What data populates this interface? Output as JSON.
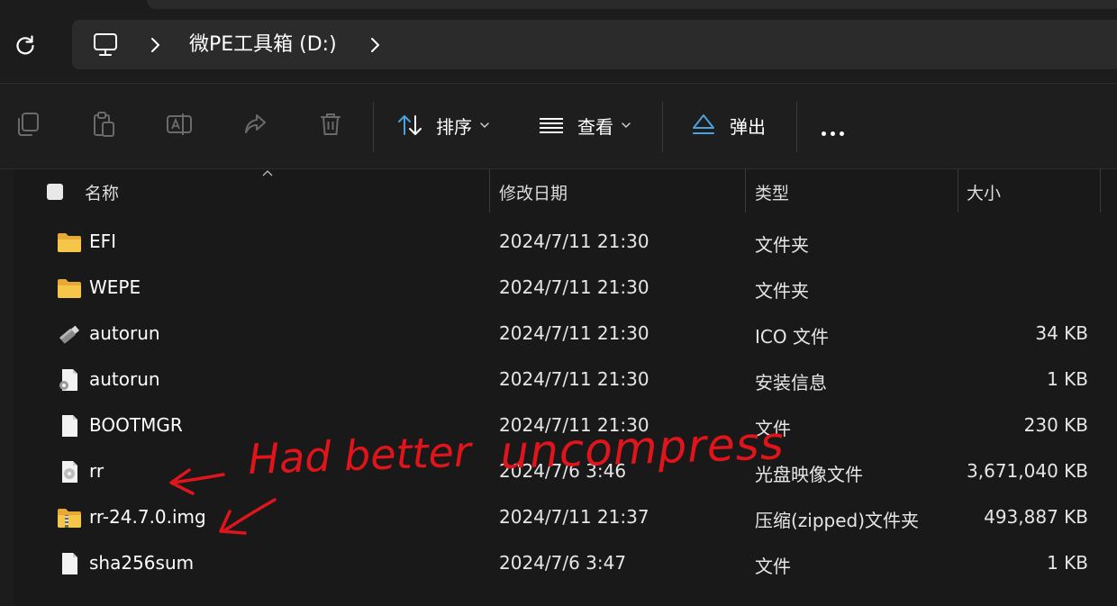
{
  "address_bar": {
    "breadcrumb": "微PE工具箱 (D:)"
  },
  "toolbar": {
    "sort_label": "排序",
    "view_label": "查看",
    "eject_label": "弹出"
  },
  "columns": {
    "name": "名称",
    "date": "修改日期",
    "type": "类型",
    "size": "大小"
  },
  "files": [
    {
      "name": "EFI",
      "date": "2024/7/11 21:30",
      "type": "文件夹",
      "size": "",
      "icon": "folder-icon"
    },
    {
      "name": "WEPE",
      "date": "2024/7/11 21:30",
      "type": "文件夹",
      "size": "",
      "icon": "folder-icon"
    },
    {
      "name": "autorun",
      "date": "2024/7/11 21:30",
      "type": "ICO 文件",
      "size": "34 KB",
      "icon": "usb-drive-icon"
    },
    {
      "name": "autorun",
      "date": "2024/7/11 21:30",
      "type": "安装信息",
      "size": "1 KB",
      "icon": "setup-info-icon"
    },
    {
      "name": "BOOTMGR",
      "date": "2024/7/11 21:30",
      "type": "文件",
      "size": "230 KB",
      "icon": "file-icon"
    },
    {
      "name": "rr",
      "date": "2024/7/6 3:46",
      "type": "光盘映像文件",
      "size": "3,671,040 KB",
      "icon": "disc-image-icon"
    },
    {
      "name": "rr-24.7.0.img",
      "date": "2024/7/11 21:37",
      "type": "压缩(zipped)文件夹",
      "size": "493,887 KB",
      "icon": "zip-folder-icon"
    },
    {
      "name": "sha256sum",
      "date": "2024/7/6 3:47",
      "type": "文件",
      "size": "1 KB",
      "icon": "file-icon"
    }
  ],
  "annotation": {
    "text_left": "Had better",
    "text_right": "uncompress",
    "color": "#e0141b"
  },
  "colors": {
    "background": "#191919",
    "address_bar": "#2b2b2b",
    "accent_blue": "#4aa3df",
    "folder_yellow": "#f6c64a"
  }
}
